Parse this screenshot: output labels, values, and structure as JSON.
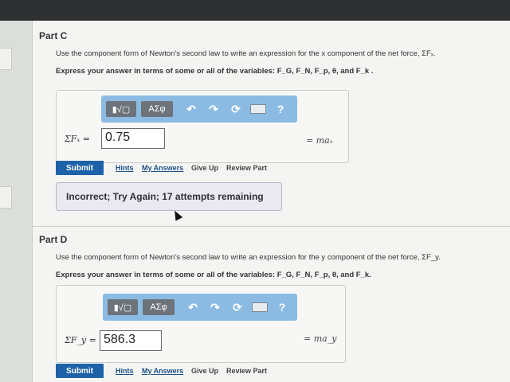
{
  "partC": {
    "title": "Part C",
    "instruction": "Use the component form of Newton's second law to write an expression for the x component of the net force, ΣFₓ.",
    "express": "Express your answer in terms of some or all of the variables: F_G, F_N, F_p, θ, and F_k .",
    "toolbar": {
      "templates": "▮√▢",
      "symbols": "ΑΣφ",
      "undo": "↶",
      "redo": "↷",
      "reset": "⟳",
      "help": "?"
    },
    "var_label": "ΣFₓ =",
    "input_value": "0.75",
    "rhs": "= maₓ",
    "submit": "Submit",
    "links": {
      "hints": "Hints",
      "my_answers": "My Answers",
      "give_up": "Give Up",
      "review_part": "Review Part"
    },
    "feedback": "Incorrect; Try Again; 17 attempts remaining"
  },
  "partD": {
    "title": "Part D",
    "instruction": "Use the component form of Newton's second law to write an expression for the y component of the net force, ΣF_y.",
    "express": "Express your answer in terms of some or all of the variables: F_G, F_N, F_p, θ, and F_k.",
    "toolbar": {
      "templates": "▮√▢",
      "symbols": "ΑΣφ",
      "undo": "↶",
      "redo": "↷",
      "reset": "⟳",
      "help": "?"
    },
    "var_label": "ΣF_y =",
    "input_value": "586.3",
    "rhs": "= ma_y",
    "submit": "Submit",
    "links": {
      "hints": "Hints",
      "my_answers": "My Answers",
      "give_up": "Give Up",
      "review_part": "Review Part"
    }
  }
}
